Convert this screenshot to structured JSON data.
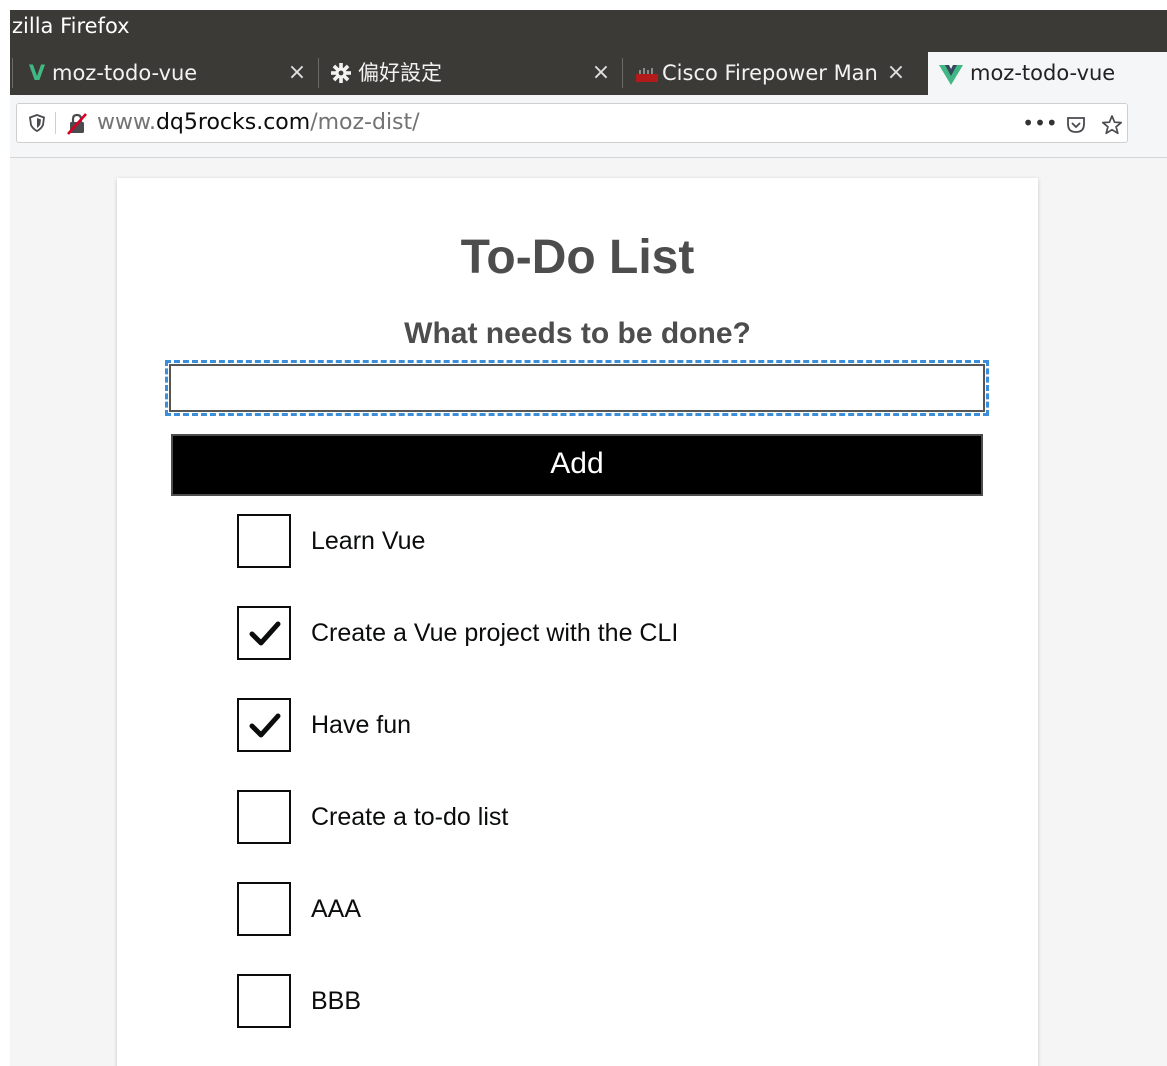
{
  "window": {
    "title": "zilla Firefox"
  },
  "tabs": [
    {
      "icon": "vue-logo-icon",
      "label": "moz-todo-vue",
      "close": "×",
      "active": false
    },
    {
      "icon": "gear-icon",
      "label": "偏好設定",
      "close": "×",
      "active": false
    },
    {
      "icon": "cisco-logo-icon",
      "label": "Cisco Firepower Man",
      "close": "×",
      "active": false
    },
    {
      "icon": "vue-logo-icon",
      "label": "moz-todo-vue",
      "active": true
    }
  ],
  "urlbar": {
    "prefix": "www.",
    "host": "dq5rocks.com",
    "path": "/moz-dist/",
    "actions": {
      "more": "•••",
      "pocket": "pocket-icon",
      "bookmark": "star-icon"
    }
  },
  "app": {
    "title": "To-Do List",
    "input_label": "What needs to be done?",
    "input_value": "",
    "add_label": "Add",
    "todos": [
      {
        "label": "Learn Vue",
        "done": false
      },
      {
        "label": "Create a Vue project with the CLI",
        "done": true
      },
      {
        "label": "Have fun",
        "done": true
      },
      {
        "label": "Create a to-do list",
        "done": false
      },
      {
        "label": "AAA",
        "done": false
      },
      {
        "label": "BBB",
        "done": false
      }
    ]
  },
  "colors": {
    "chrome_dark": "#3b3a36",
    "vue_green": "#41b883",
    "focus_outline": "#3a8fd8",
    "text_heading": "#4d4d4d"
  }
}
